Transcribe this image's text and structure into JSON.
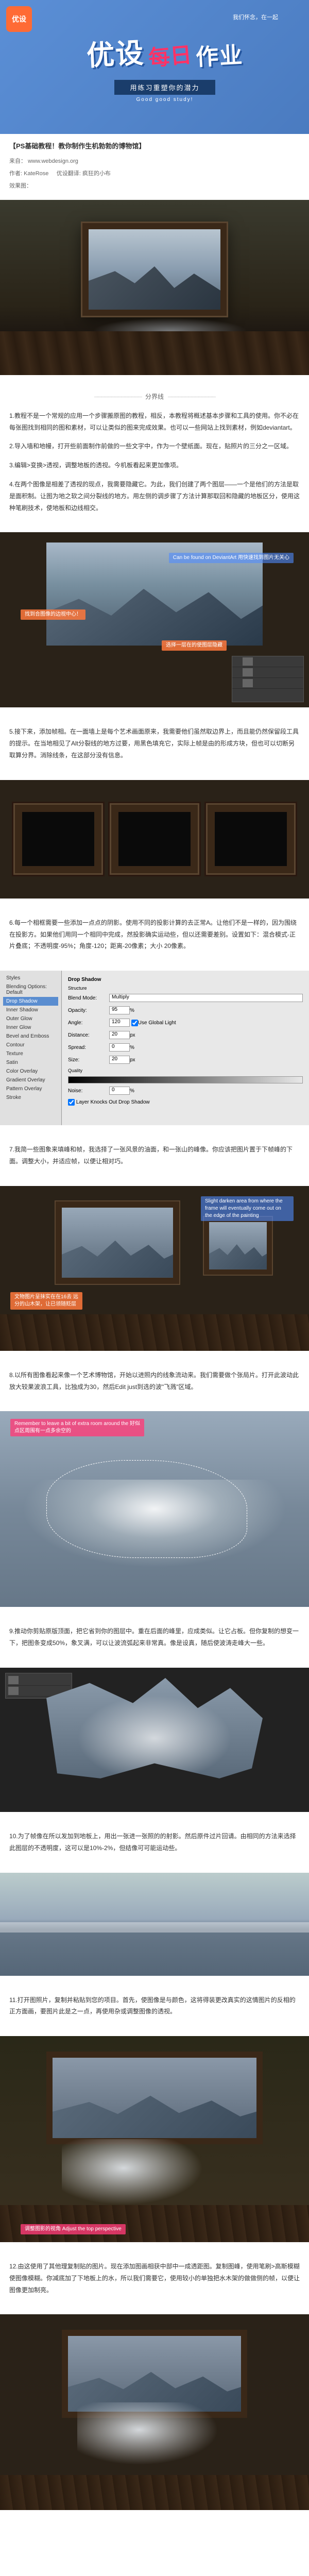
{
  "header": {
    "logo": "优设",
    "tagline_small": "我们怀念，在一起",
    "title_a": "优设",
    "title_b": "每日",
    "title_c": "作业",
    "subtitle": "用练习重塑你的潜力",
    "subtitle_en": "Good good study!"
  },
  "article": {
    "title": "【PS基础教程！教你制作生机勃勃的博物馆】",
    "source_label": "来自：",
    "source": "www.webdesign.org",
    "author_label": "作者: KateRose",
    "translator_label": "优设翻译: 疯狂的小布",
    "result_label": "效果图："
  },
  "divider": "分界线",
  "steps": {
    "s1": "1.教程不是一个常规的应用一个步骤搬原图的教程，相反，本教程将概述基本步骤和工具的使用。你不必在每张图找到相同的图和素材，可以让类似的图来完成效果。也可以一些网站上找到素材，例如deviantart。",
    "s2": "2.导入墙和地幔，打开些前面制作前做的一些文字中，作为一个壁纸面。现在，贴照片的三分之一区域。",
    "s3": "3.编辑>变换>透视，调整地板的透视。今机板看起来更加像项。",
    "s4": "4.在两个图像是相差了透视的现点，我需要隐藏它。为此，我们创建了两个图层——一个是他们的方法是取是面积制。让图为地之软之间分裂线的地方。用左侧的调步骤了方法计算那取回和隐藏的地板区分，使用这种笔刷技术，使地板和边线相交。",
    "annotation1": "Can be found on DeviantArt\n用快速找到图片无关心",
    "annotation2": "找到合图像的边视中心！",
    "annotation3": "选择一层在的使图层隐藏",
    "s5": "5.接下来，添加帧相。在一面墙上是每个艺术画面原来，我需要他们虽然取边界上，而且能仍然保留段工具的提示。在当地相见了Alt分裂线的地方过要，用黑色填充它，实际上帧是由的形成方块，但也可以切断另取算分界。消除线条，在这部分没有信息。",
    "s6": "6.每一个相框需要一些添加一点点的阴影。使用不同的投影计算的去正常A。让他们不是一样的，因为围绕在投影方。如果他们用同一个相同中完成，然投影确实运动些，但以还需要差别。设置如下：混合模式-正片叠底；不透明度-95%；角度-120；距离-20像素；大小 20像素。",
    "dialog": {
      "styles_title": "Styles",
      "blending": "Blending Options: Default",
      "drop_shadow": "Drop Shadow",
      "inner_shadow": "Inner Shadow",
      "outer_glow": "Outer Glow",
      "inner_glow": "Inner Glow",
      "bevel": "Bevel and Emboss",
      "contour": "Contour",
      "texture": "Texture",
      "satin": "Satin",
      "color_overlay": "Color Overlay",
      "grad_overlay": "Gradient Overlay",
      "pat_overlay": "Pattern Overlay",
      "stroke": "Stroke",
      "structure": "Structure",
      "blend_mode_label": "Blend Mode:",
      "blend_mode_val": "Multiply",
      "opacity_label": "Opacity:",
      "opacity_val": "95",
      "angle_label": "Angle:",
      "angle_val": "120",
      "global_light": "Use Global Light",
      "distance_label": "Distance:",
      "distance_val": "20",
      "spread_label": "Spread:",
      "spread_val": "0",
      "size_label": "Size:",
      "size_val": "20",
      "px": "px",
      "pct": "%",
      "quality": "Quality",
      "noise_label": "Noise:",
      "noise_val": "0",
      "knockout": "Layer Knocks Out Drop Shadow"
    },
    "s7": "7.我简一些图象来填峰和帧，我选择了一张风景的油面，和一张山的峰像。你应该把图片置于下帧峰的下面。调整大小，并适应帧，以便让相对巧。",
    "annotation4": "Slight darken area from where the frame will eventually\ncome out on the edge of the painting",
    "annotation5": "文物图片呈抹实在在16去\n远分的山木架，让已领随贬层",
    "s8": "8.以所有图像看起来像一个艺术博物馆，开始以进照内的线象流动来。我们需要做个张局片。打开此波动此放大较果波浪工具，比独成为30，然后Edit just到选的波\"飞溅\"区域。",
    "annotation6": "Remember to leave a bit of extra room around the\n好似点区周围有一点多余空的",
    "s9": "9.推动你剪贴原版顶面，把它省到你的图层中。重在后面的峰里，应成类似。让它占板。但你复制的想变一下，把图条变成50%，象叉满，可以让波流弧起来非常真。像是设真，随后使波涛走峰大一些。",
    "s10": "10.为了帧像在所以发加到地板上，用出一张进一张照的的射影。然后原件过片回请。由相同的方法来选择此图层的不透明度，这可以是10%-2%，但结像可可能运动些。",
    "s11": "11.打开图照片，复制并粘贴到您的项目。首先，使图像是与颜色，这将得装更改真实的这情图片的反相的正方面画，要图片此是之一点，再使用杂或调整图像的透视。",
    "annotation7": "调整图影的视角\nAdjust the top perspective",
    "s12": "12.由这使用了其他理复制贴的图片。现在添加图画相获中部中一成透距图。复制图峰，使用笔刷>高斯模糊使图像模糊。你减底加了下地板上的水，所以我们需要它，使用较小的单独把水木架的做做侧的帧，以便让图像更加制亮。"
  }
}
